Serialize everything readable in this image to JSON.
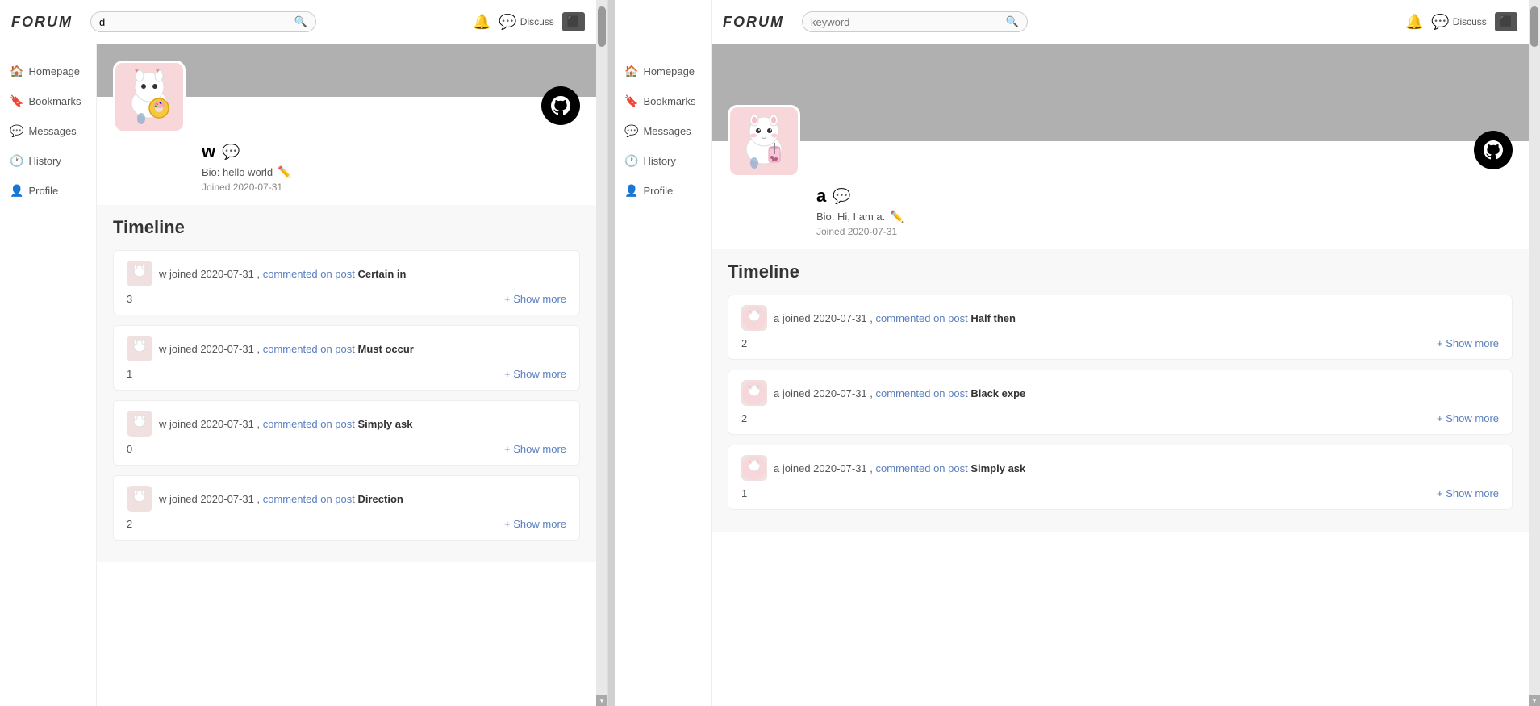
{
  "left_panel": {
    "header": {
      "logo": "FORUM",
      "search_placeholder": "d",
      "discuss_label": "Discuss"
    },
    "sidebar": {
      "items": [
        {
          "id": "homepage",
          "label": "Homepage",
          "icon": "🏠"
        },
        {
          "id": "bookmarks",
          "label": "Bookmarks",
          "icon": "🔖"
        },
        {
          "id": "messages",
          "label": "Messages",
          "icon": "💬"
        },
        {
          "id": "history",
          "label": "History",
          "icon": "🕐"
        },
        {
          "id": "profile",
          "label": "Profile",
          "icon": "👤"
        }
      ]
    },
    "profile": {
      "username": "w",
      "bio": "Bio: hello world",
      "joined": "Joined 2020-07-31",
      "timeline_title": "Timeline"
    },
    "timeline": [
      {
        "username": "w",
        "date": "joined 2020-07-31",
        "action": "commented on post",
        "post": "Certain in",
        "count": "3",
        "show_more": "+ Show more"
      },
      {
        "username": "w",
        "date": "joined 2020-07-31",
        "action": "commented on post",
        "post": "Must occur",
        "count": "1",
        "show_more": "+ Show more"
      },
      {
        "username": "w",
        "date": "joined 2020-07-31",
        "action": "commented on post",
        "post": "Simply ask",
        "count": "0",
        "show_more": "+ Show more"
      },
      {
        "username": "w",
        "date": "joined 2020-07-31",
        "action": "commented on post",
        "post": "Direction",
        "count": "2",
        "show_more": "+ Show more"
      }
    ]
  },
  "right_panel": {
    "header": {
      "logo": "FORUM",
      "search_placeholder": "keyword",
      "discuss_label": "Discuss"
    },
    "sidebar": {
      "items": [
        {
          "id": "homepage",
          "label": "Homepage",
          "icon": "🏠"
        },
        {
          "id": "bookmarks",
          "label": "Bookmarks",
          "icon": "🔖"
        },
        {
          "id": "messages",
          "label": "Messages",
          "icon": "💬"
        },
        {
          "id": "history",
          "label": "History",
          "icon": "🕐"
        },
        {
          "id": "profile",
          "label": "Profile",
          "icon": "👤"
        }
      ]
    },
    "profile": {
      "username": "a",
      "bio": "Bio: Hi, I am a.",
      "joined": "Joined 2020-07-31",
      "timeline_title": "Timeline"
    },
    "timeline": [
      {
        "username": "a",
        "date": "joined 2020-07-31",
        "action": "commented on post",
        "post": "Half then",
        "count": "2",
        "show_more": "+ Show more"
      },
      {
        "username": "a",
        "date": "joined 2020-07-31",
        "action": "commented on post",
        "post": "Black expe",
        "count": "2",
        "show_more": "+ Show more"
      },
      {
        "username": "a",
        "date": "joined 2020-07-31",
        "action": "commented on post",
        "post": "Simply ask",
        "count": "1",
        "show_more": "+ Show more"
      }
    ]
  }
}
